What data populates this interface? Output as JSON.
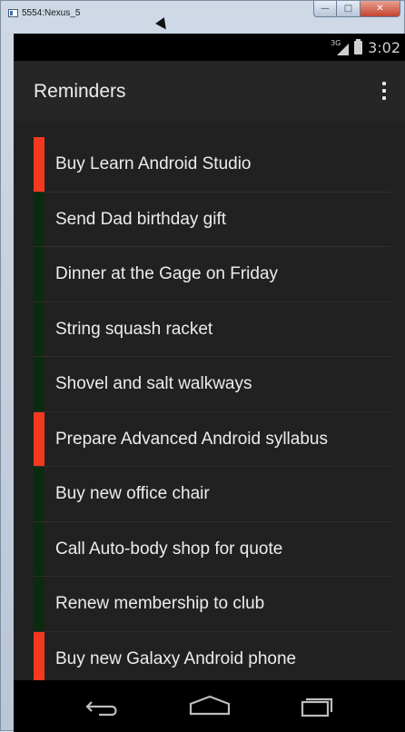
{
  "window": {
    "title": "5554:Nexus_5",
    "controls": {
      "minimize": "—",
      "maximize": "□",
      "close": "✕"
    }
  },
  "status_bar": {
    "network": "3G",
    "time": "3:02"
  },
  "action_bar": {
    "title": "Reminders",
    "overflow_icon": "overflow-menu-icon"
  },
  "colors": {
    "important": "#f4391e",
    "normal": "#0c2a10"
  },
  "reminders": [
    {
      "text": "Buy Learn Android Studio",
      "important": true
    },
    {
      "text": "Send Dad birthday gift",
      "important": false
    },
    {
      "text": "Dinner at the Gage on Friday",
      "important": false
    },
    {
      "text": "String squash racket",
      "important": false
    },
    {
      "text": "Shovel and salt walkways",
      "important": false
    },
    {
      "text": "Prepare Advanced Android syllabus",
      "important": true
    },
    {
      "text": "Buy new office chair",
      "important": false
    },
    {
      "text": "Call Auto-body shop for quote",
      "important": false
    },
    {
      "text": "Renew membership to club",
      "important": false
    },
    {
      "text": "Buy new Galaxy Android phone",
      "important": true
    }
  ],
  "nav_bar": {
    "back": "back-icon",
    "home": "home-icon",
    "recents": "recents-icon"
  }
}
